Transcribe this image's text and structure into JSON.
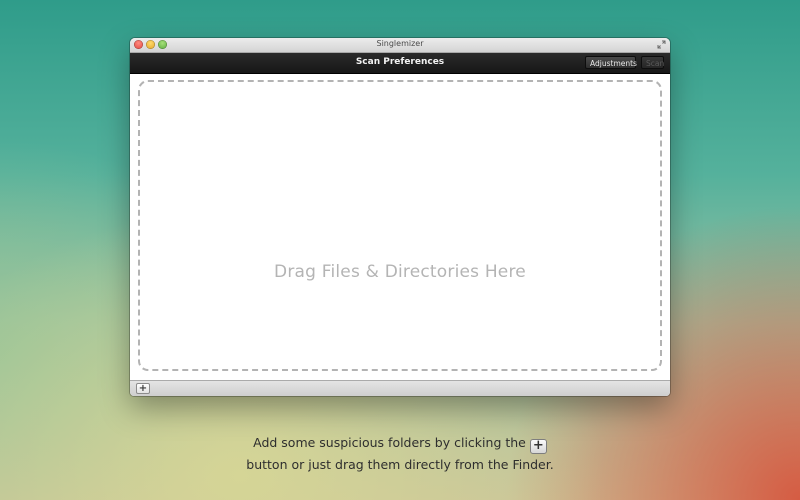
{
  "window": {
    "title": "Singlemizer",
    "controls": {
      "close_icon": "close-dot",
      "minimize_icon": "minimize-dot",
      "zoom_icon": "zoom-dot",
      "fullscreen_icon": "fullscreen-arrows-icon"
    }
  },
  "toolbar": {
    "title": "Scan Preferences",
    "adjustments_label": "Adjustments",
    "scan_label": "Scan"
  },
  "content": {
    "drop_zone_text": "Drag Files & Directories Here"
  },
  "bottombar": {
    "add_label": "+"
  },
  "caption": {
    "line1": "Add some suspicious folders by clicking the",
    "plus_glyph": "+",
    "line2": "button or just drag them directly from the Finder."
  },
  "colors": {
    "background_top": "#2f9c8a",
    "background_bottom_right": "#d6563e",
    "toolbar": "#1f1f1f",
    "drop_zone_border": "#b3b3b3",
    "drop_zone_text": "#b4b4b4"
  }
}
